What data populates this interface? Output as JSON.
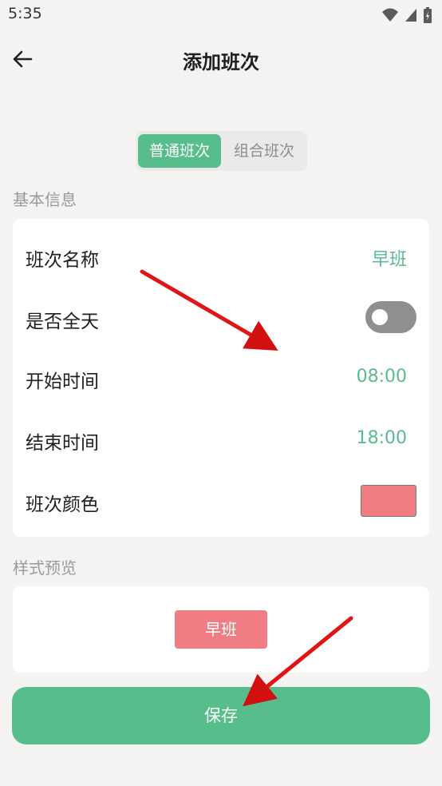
{
  "status_bar": {
    "time": "5:35"
  },
  "header": {
    "title": "添加班次"
  },
  "tabs": [
    {
      "label": "普通班次",
      "active": true
    },
    {
      "label": "组合班次",
      "active": false
    }
  ],
  "basic_info": {
    "section_label": "基本信息",
    "rows": [
      {
        "label": "班次名称",
        "value": "早班"
      },
      {
        "label": "是否全天",
        "toggle_on": false
      },
      {
        "label": "开始时间",
        "value": "08:00"
      },
      {
        "label": "结束时间",
        "value": "18:00"
      },
      {
        "label": "班次颜色",
        "swatch_color": "#f07d83"
      }
    ]
  },
  "preview": {
    "section_label": "样式预览",
    "chip_label": "早班",
    "chip_color": "#f07d83"
  },
  "save_label": "保存",
  "colors": {
    "accent": "#56bd8b",
    "annotation_arrow": "#e11515"
  }
}
